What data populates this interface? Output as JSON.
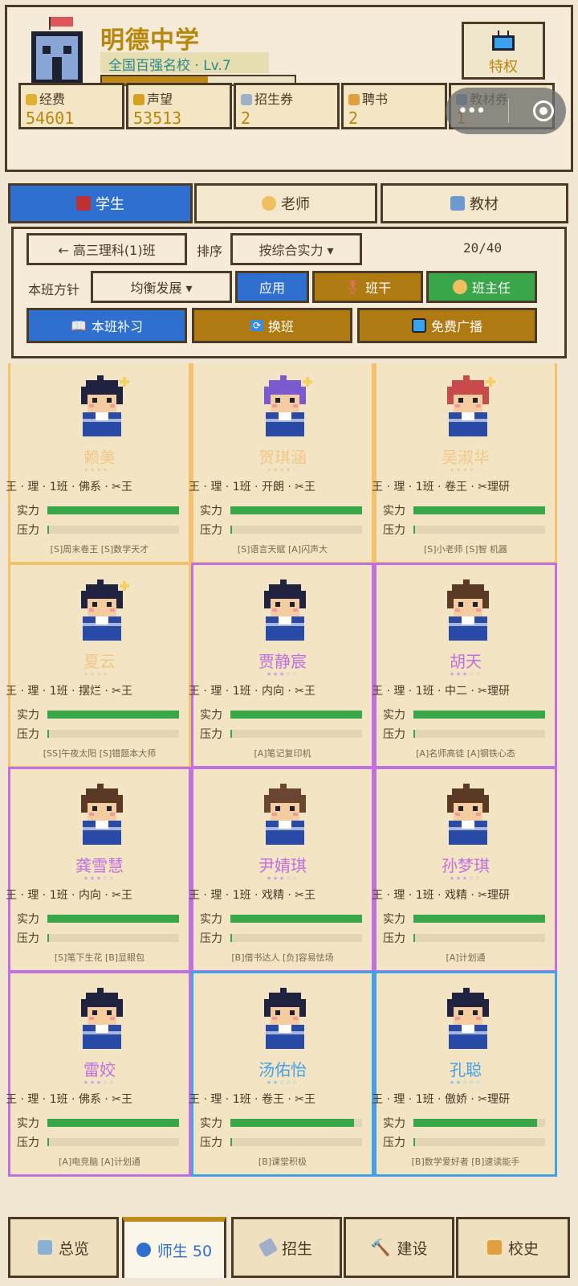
{
  "header": {
    "school_name": "明德中学",
    "rank_text": "全国百强名校 · Lv.7",
    "xp_progress": 0.55,
    "privilege_label": "特权",
    "resources": [
      {
        "label": "经费",
        "value": "54601",
        "icon": "money-bag-icon"
      },
      {
        "label": "声望",
        "value": "53513",
        "icon": "trophy-icon"
      },
      {
        "label": "招生券",
        "value": "2",
        "icon": "ticket-icon"
      },
      {
        "label": "聘书",
        "value": "2",
        "icon": "scroll-icon"
      },
      {
        "label": "教材券",
        "value": "1",
        "icon": "book-stack-icon"
      }
    ]
  },
  "tabs": [
    {
      "label": "学生",
      "icon": "student-icon"
    },
    {
      "label": "老师",
      "icon": "teacher-icon"
    },
    {
      "label": "教材",
      "icon": "books-icon"
    }
  ],
  "controls": {
    "class_button": "← 高三理科(1)班",
    "sort_label": "排序",
    "sort_value": "按综合实力 ▾",
    "capacity": "20/40",
    "policy_label": "本班方针",
    "policy_value": "均衡发展 ▾",
    "apply": "应用",
    "cadre": "班干",
    "head_teacher": "班主任",
    "tutoring": "本班补习",
    "change_class": "换班",
    "broadcast": "免费广播"
  },
  "card_labels": {
    "strength": "实力",
    "pressure": "压力"
  },
  "students": [
    {
      "name": "赖美",
      "stars": "★★★★☆",
      "info": "王 · 理 · 1班 · 佛系 · ✂王",
      "strength": 1.0,
      "pressure": 0.02,
      "traits": "[S]周末卷王 [S]数学天才",
      "rarity": "gold",
      "hair": "#1f2340"
    },
    {
      "name": "贺琪涵",
      "stars": "★★★★☆",
      "info": "王 · 理 · 1班 · 开朗 · ✂王",
      "strength": 1.0,
      "pressure": 0.02,
      "traits": "[S]语言天赋 [A]闪声大",
      "rarity": "gold",
      "hair": "#7b5ad0"
    },
    {
      "name": "吴淑华",
      "stars": "★★★★☆",
      "info": "王 · 理 · 1班 · 卷王 · ✂理研",
      "strength": 1.0,
      "pressure": 0.02,
      "traits": "[S]小老师 [S]智 机器",
      "rarity": "gold",
      "hair": "#c84a4a"
    },
    {
      "name": "夏云",
      "stars": "★★★★☆",
      "info": "王 · 理 · 1班 · 摆烂 · ✂王",
      "strength": 1.0,
      "pressure": 0.02,
      "traits": "[SS]午夜太阳 [S]错题本大师",
      "rarity": "gold",
      "hair": "#1f2340"
    },
    {
      "name": "贾静宸",
      "stars": "★★★☆☆",
      "info": "王 · 理 · 1班 · 内向 · ✂王",
      "strength": 1.0,
      "pressure": 0.02,
      "traits": "[A]笔记复印机",
      "rarity": "purple",
      "hair": "#1f2340"
    },
    {
      "name": "胡天",
      "stars": "★★★☆☆",
      "info": "王 · 理 · 1班 · 中二 · ✂理研",
      "strength": 1.0,
      "pressure": 0.02,
      "traits": "[A]名师高徒 [A]钢铁心态",
      "rarity": "purple",
      "hair": "#5a3a24"
    },
    {
      "name": "龚雪慧",
      "stars": "★★★☆☆",
      "info": "王 · 理 · 1班 · 内向 · ✂王",
      "strength": 1.0,
      "pressure": 0.02,
      "traits": "[S]笔下生花 [B]显眼包",
      "rarity": "purple",
      "hair": "#5a3a24"
    },
    {
      "name": "尹婧琪",
      "stars": "★★★☆☆",
      "info": "王 · 理 · 1班 · 戏精 · ✂王",
      "strength": 1.0,
      "pressure": 0.02,
      "traits": "[B]借书达人 [负]容易怯场",
      "rarity": "purple",
      "hair": "#6a4632"
    },
    {
      "name": "孙梦琪",
      "stars": "★★★☆☆",
      "info": "王 · 理 · 1班 · 戏精 · ✂理研",
      "strength": 1.0,
      "pressure": 0.02,
      "traits": "[A]计划通",
      "rarity": "purple",
      "hair": "#5a3a24"
    },
    {
      "name": "雷姣",
      "stars": "★★★☆☆",
      "info": "王 · 理 · 1班 · 佛系 · ✂王",
      "strength": 1.0,
      "pressure": 0.02,
      "traits": "[A]电竞脑 [A]计划通",
      "rarity": "purple",
      "hair": "#1f2340"
    },
    {
      "name": "汤佑怡",
      "stars": "★★☆☆☆",
      "info": "王 · 理 · 1班 · 卷王 · ✂王",
      "strength": 0.94,
      "pressure": 0.02,
      "traits": "[B]课堂积极",
      "rarity": "blue",
      "hair": "#1f2340"
    },
    {
      "name": "孔聪",
      "stars": "★★☆☆☆",
      "info": "王 · 理 · 1班 · 傲娇 · ✂理研",
      "strength": 0.94,
      "pressure": 0.02,
      "traits": "[B]数学爱好者 [B]速读能手",
      "rarity": "blue",
      "hair": "#1f2340"
    }
  ],
  "bottom_nav": [
    {
      "label": "总览",
      "icon": "building-icon"
    },
    {
      "label": "师生 50",
      "icon": "people-icon"
    },
    {
      "label": "招生",
      "icon": "ticket-icon"
    },
    {
      "label": "建设",
      "icon": "hammer-icon"
    },
    {
      "label": "校史",
      "icon": "scroll-icon"
    }
  ],
  "colors": {
    "accent_blue": "#2f6fd0",
    "gold": "#b8860b",
    "green": "#3aa64a",
    "brown_btn": "#b07a12"
  }
}
